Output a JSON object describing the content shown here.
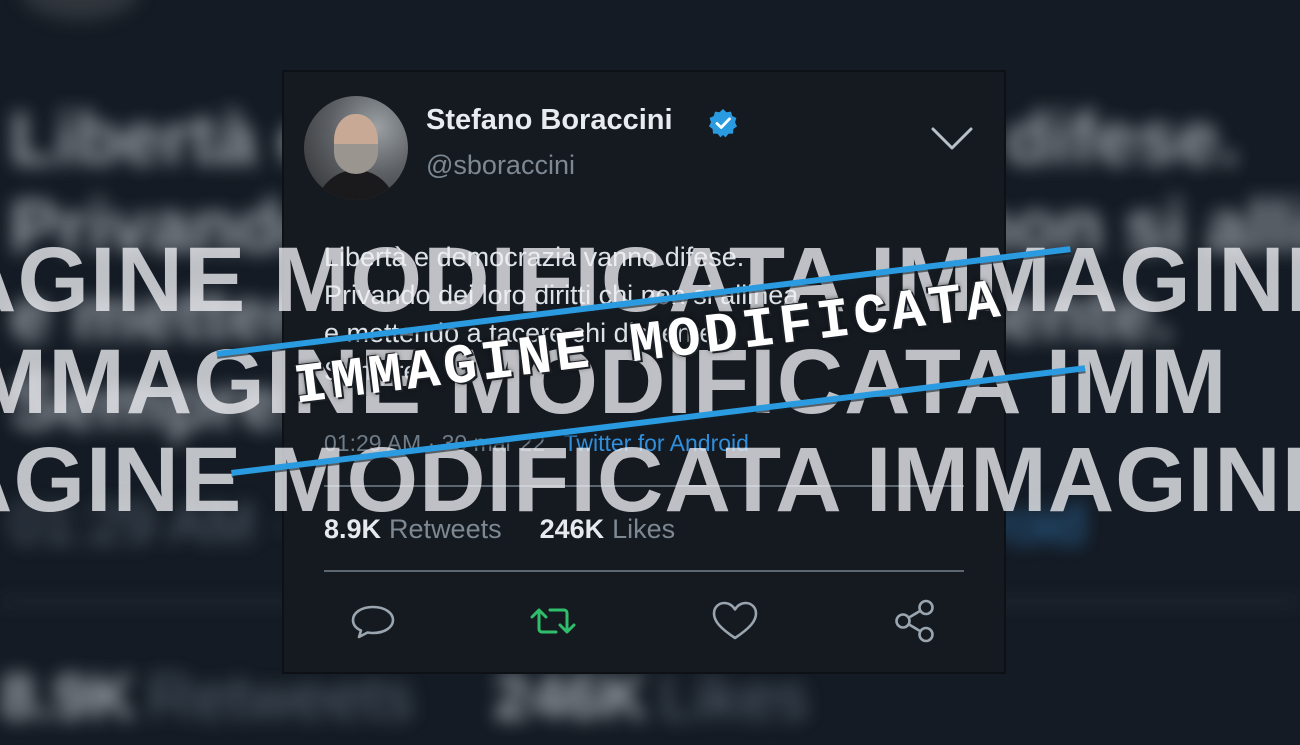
{
  "tweet": {
    "author": {
      "name": "Stefano Boraccini",
      "handle": "@sboraccini",
      "verified": true
    },
    "text_lines": [
      "Libertà e democrazia vanno difese.",
      "Privando dei loro diritti chi non si allinea",
      "e mettendo a tacere chi dissente.",
      "Sempre."
    ],
    "timestamp": "01:29 AM · 30 mar 22",
    "client": "Twitter for Android",
    "stats": {
      "retweets_count": "8.9K",
      "retweets_label": "Retweets",
      "likes_count": "246K",
      "likes_label": "Likes"
    },
    "actions": [
      "reply-icon",
      "retweet-icon",
      "like-icon",
      "share-icon"
    ]
  },
  "background": {
    "text_lines": [
      "Libertà e democrazia vanno difese.",
      "Privando dei loro diritti chi non si allinea",
      "e mettendo a tacere chi dissente.",
      "Sempre."
    ],
    "timestamp": "01:29 AM · 30 mar 22 ·",
    "client": "Twitter for Android",
    "retweets_count": "8.9K",
    "retweets_label": "Retweets",
    "likes_count": "246K",
    "likes_label": "Likes"
  },
  "watermark": {
    "row1": "AGINE  MODIFICATA  IMMAGINE",
    "row2": "IMMAGINE  MODIFICATA  IMM",
    "row3": "AGINE  MODIFICATA  IMMAGINE",
    "stamp": "IMMAGINE MODIFICATA"
  },
  "colors": {
    "background": "#141b24",
    "card": "#151a20",
    "accent_blue": "#2a9be0",
    "retweet_green": "#2fbf6b",
    "text_primary": "#dde2e7",
    "text_secondary": "#7d8893"
  }
}
